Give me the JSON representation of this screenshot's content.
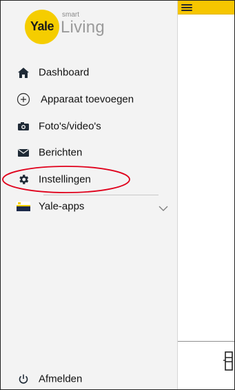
{
  "app": {
    "logo_brand": "Yale",
    "logo_tagline_small": "smart",
    "logo_tagline_large": "Living",
    "brand_yellow": "#f5cd00"
  },
  "menu": {
    "items": [
      {
        "label": "Dashboard",
        "icon": "home-icon"
      },
      {
        "label": "Apparaat toevoegen",
        "icon": "add-circle-icon"
      },
      {
        "label": "Foto's/video's",
        "icon": "camera-icon"
      },
      {
        "label": "Berichten",
        "icon": "mail-icon"
      },
      {
        "label": "Instellingen",
        "icon": "gear-icon",
        "highlighted": true
      },
      {
        "label": "Yale-apps",
        "icon": "yale-apps-icon",
        "expandable": true
      }
    ],
    "footer": {
      "label": "Afmelden",
      "icon": "power-icon"
    }
  },
  "annotation_color": "#e0001b",
  "topbar_color": "#f6c600"
}
